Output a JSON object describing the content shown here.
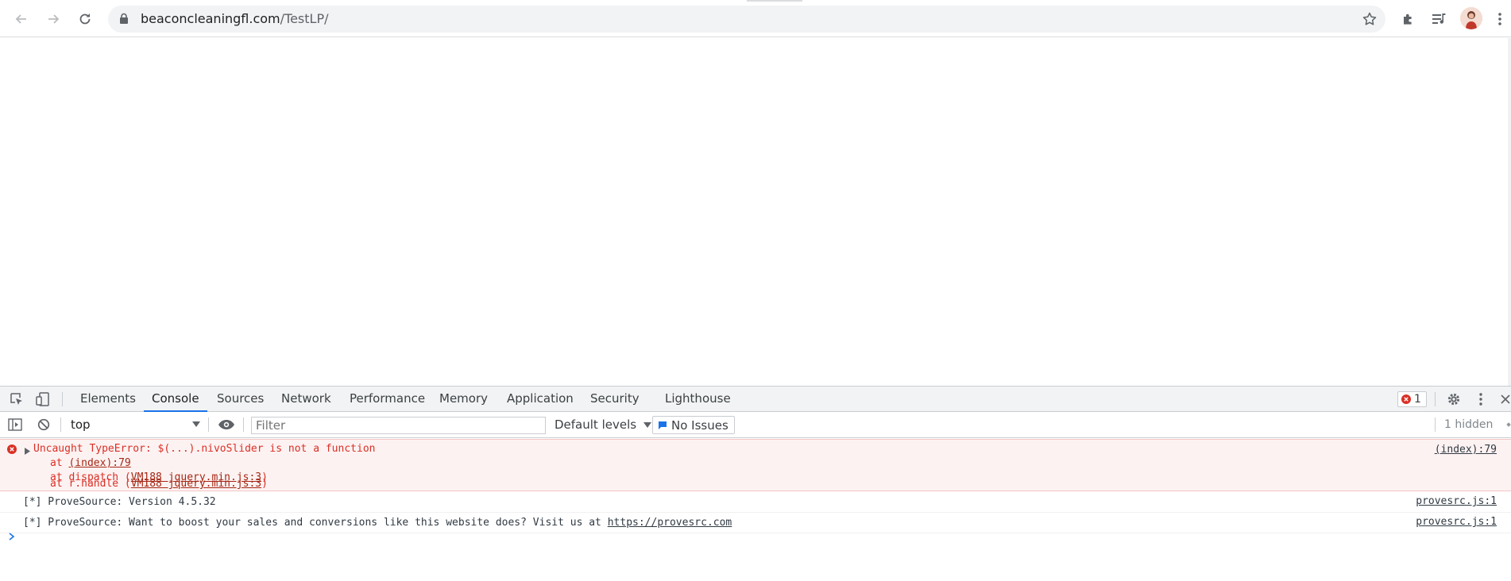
{
  "browser": {
    "url_domain": "beaconcleaningfl.com",
    "url_path": "/TestLP/"
  },
  "devtools": {
    "tabs": [
      {
        "label": "Elements"
      },
      {
        "label": "Console"
      },
      {
        "label": "Sources"
      },
      {
        "label": "Network"
      },
      {
        "label": "Performance"
      },
      {
        "label": "Memory"
      },
      {
        "label": "Application"
      },
      {
        "label": "Security"
      },
      {
        "label": "Lighthouse"
      }
    ],
    "active_tab": "Console",
    "error_count": "1",
    "filterbar": {
      "context": "top",
      "filter_placeholder": "Filter",
      "levels": "Default levels",
      "issues": "No Issues",
      "hidden": "1 hidden"
    }
  },
  "console": {
    "error": {
      "message": "Uncaught TypeError: $(...).nivoSlider is not a function",
      "source": "(index):79",
      "stack": [
        {
          "prefix": "at ",
          "link": "(index):79",
          "suffix": ""
        },
        {
          "prefix": "at dispatch (",
          "link": "VM188 jquery.min.js:3",
          "suffix": ")"
        },
        {
          "prefix": "at r.handle (",
          "link": "VM188 jquery.min.js:3",
          "suffix": ")"
        }
      ]
    },
    "logs": [
      {
        "text": "[*] ProveSource: Version 4.5.32",
        "link": "",
        "source": "provesrc.js:1"
      },
      {
        "text": "[*] ProveSource: Want to boost your sales and conversions like this website does? Visit us at ",
        "link": "https://provesrc.com",
        "source": "provesrc.js:1"
      }
    ]
  }
}
